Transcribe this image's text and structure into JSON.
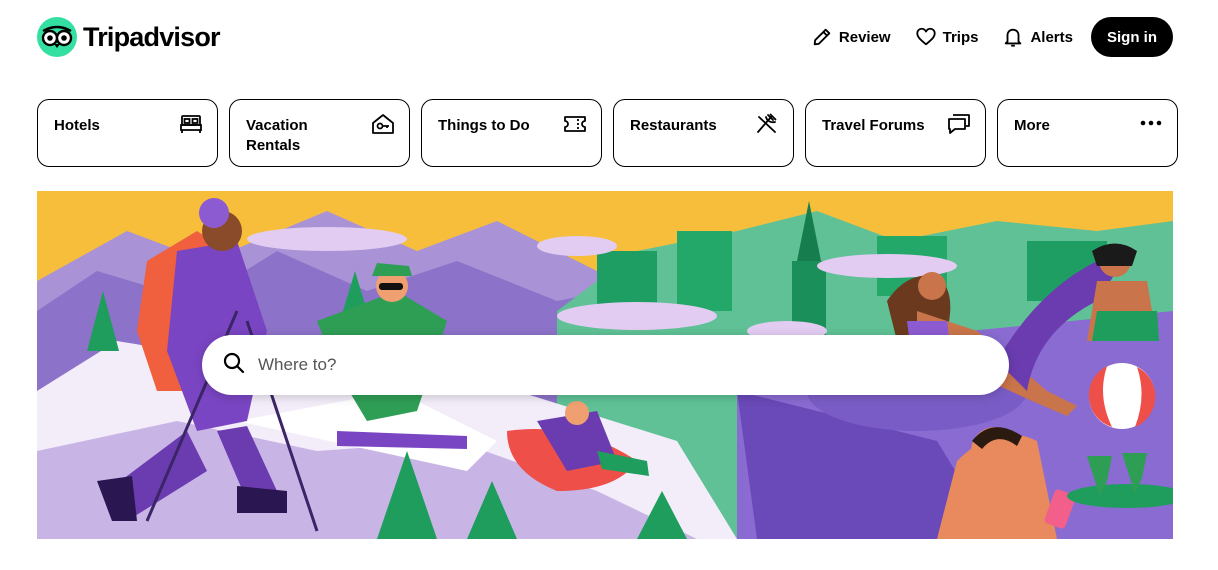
{
  "header": {
    "logo_text": "Tripadvisor",
    "nav": [
      {
        "label": "Review",
        "icon": "pencil-icon"
      },
      {
        "label": "Trips",
        "icon": "heart-icon"
      },
      {
        "label": "Alerts",
        "icon": "bell-icon"
      }
    ],
    "signin_label": "Sign in"
  },
  "categories": [
    {
      "label": "Hotels",
      "icon": "bed-icon"
    },
    {
      "label": "Vacation Rentals",
      "icon": "house-key-icon"
    },
    {
      "label": "Things to Do",
      "icon": "ticket-icon"
    },
    {
      "label": "Restaurants",
      "icon": "fork-knife-icon"
    },
    {
      "label": "Travel Forums",
      "icon": "chat-bubbles-icon"
    },
    {
      "label": "More",
      "icon": "more-dots-icon"
    }
  ],
  "search": {
    "placeholder": "Where to?",
    "value": ""
  },
  "colors": {
    "brand_green": "#34E0A1",
    "hero_sky": "#F7BE3B",
    "button_black": "#000000"
  }
}
